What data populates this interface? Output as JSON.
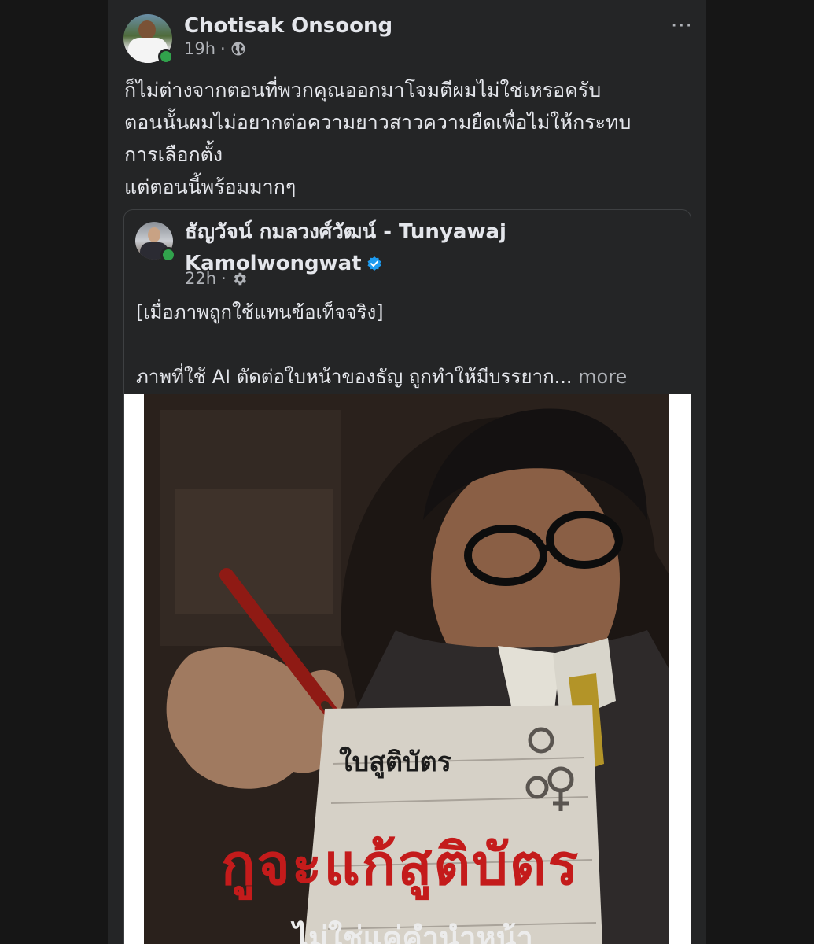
{
  "post": {
    "author_name": "Chotisak Onsoong",
    "timestamp": "19h",
    "privacy_icon": "globe-icon",
    "more_icon": "···",
    "text_lines": [
      "ก็ไม่ต่างจากตอนที่พวกคุณออกมาโจมตีผมไม่ใช่เหรอครับ",
      "ตอนนั้นผมไม่อยากต่อความยาวสาวความยืดเพื่อไม่ให้กระทบ",
      "การเลือกตั้ง",
      "แต่ตอนนี้พร้อมมากๆ"
    ]
  },
  "shared_post": {
    "author_name": "ธัญวัจน์ กมลวงศ์วัฒน์ - Tunyawaj Kamolwongwat",
    "verified": true,
    "timestamp": "22h",
    "privacy_icon": "gear-icon",
    "text_line1": "[เมื่อภาพถูกใช้แทนข้อเท็จจริง]",
    "text_line2": "ภาพที่ใช้ AI ตัดต่อใบหน้าของธัญ ถูกทำให้มีบรรยาก...",
    "see_more_label": "more",
    "image": {
      "title_small": "ใบสูติบัตร",
      "title_big": "กูจะแก้สูติบัตร",
      "tagline": "ไม่ใช่แค่คำนำหน้า"
    }
  },
  "colors": {
    "card_bg": "#242526",
    "text_primary": "#e4e6eb",
    "text_secondary": "#b0b3b8",
    "online_green": "#31a24c",
    "verified_blue": "#1d9bf0",
    "poster_red": "#c41b1b"
  }
}
